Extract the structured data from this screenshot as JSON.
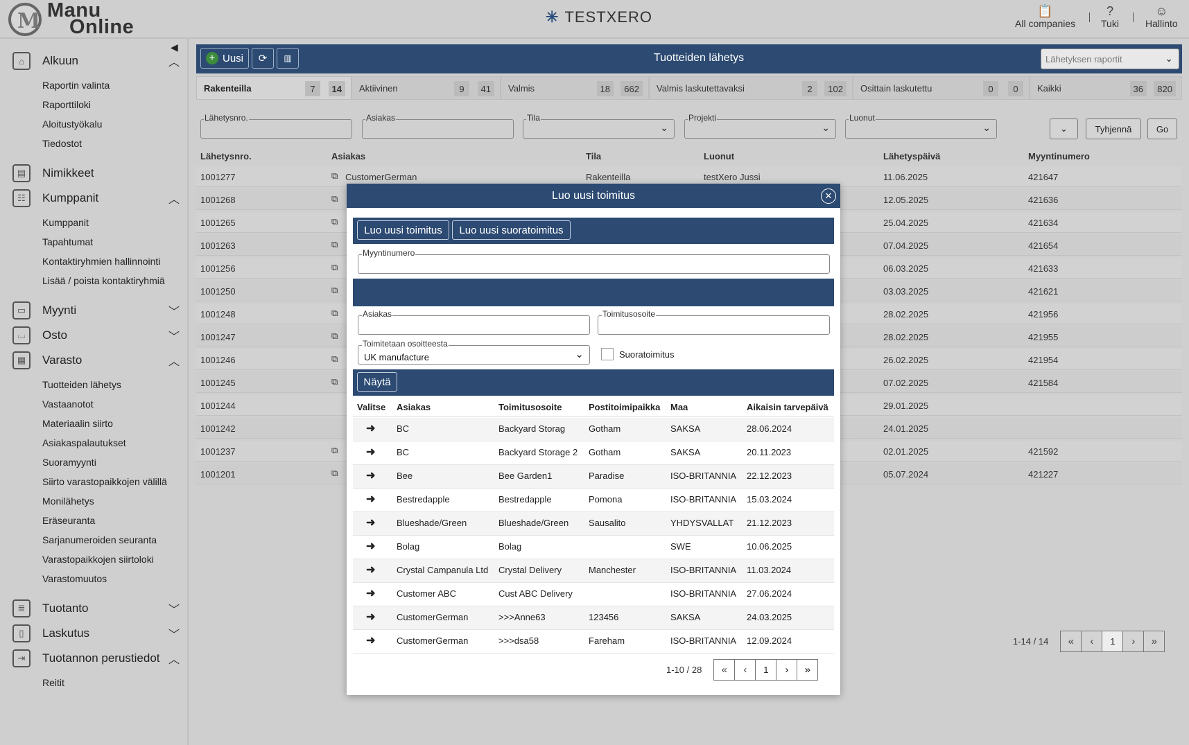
{
  "header": {
    "logo_line1": "Manu",
    "logo_line2": "Online",
    "company": "TESTXERO",
    "all_companies": "All companies",
    "support": "Tuki",
    "admin": "Hallinto"
  },
  "sidebar": {
    "sections": [
      {
        "label": "Alkuun",
        "icon": "home-icon",
        "chevron": "up",
        "items": [
          "Raportin valinta",
          "Raporttiloki",
          "Aloitustyökalu",
          "Tiedostot"
        ]
      },
      {
        "label": "Nimikkeet",
        "icon": "inbox-icon",
        "chevron": "",
        "items": []
      },
      {
        "label": "Kumppanit",
        "icon": "contacts-icon",
        "chevron": "up",
        "items": [
          "Kumppanit",
          "Tapahtumat",
          "Kontaktiryhmien hallinnointi",
          "Lisää / poista kontaktiryhmiä"
        ]
      },
      {
        "label": "Myynti",
        "icon": "register-icon",
        "chevron": "down",
        "items": []
      },
      {
        "label": "Osto",
        "icon": "basket-icon",
        "chevron": "down",
        "items": []
      },
      {
        "label": "Varasto",
        "icon": "warehouse-icon",
        "chevron": "up",
        "items": [
          "Tuotteiden lähetys",
          "Vastaanotot",
          "Materiaalin siirto",
          "Asiakaspalautukset",
          "Suoramyynti",
          "Siirto varastopaikkojen välillä",
          "Monilähetys",
          "Eräseuranta",
          "Sarjanumeroiden seuranta",
          "Varastopaikkojen siirtoloki",
          "Varastomuutos"
        ]
      },
      {
        "label": "Tuotanto",
        "icon": "database-icon",
        "chevron": "down",
        "items": []
      },
      {
        "label": "Laskutus",
        "icon": "invoice-icon",
        "chevron": "down",
        "items": []
      },
      {
        "label": "Tuotannon perustiedot",
        "icon": "export-icon",
        "chevron": "up",
        "items": [
          "Reitit"
        ]
      }
    ]
  },
  "toolbar": {
    "new_label": "Uusi",
    "title": "Tuotteiden lähetys",
    "reports_placeholder": "Lähetyksen raportit"
  },
  "tabs": [
    {
      "label": "Rakenteilla",
      "a": "7",
      "b": "14"
    },
    {
      "label": "Aktiivinen",
      "a": "9",
      "b": "41"
    },
    {
      "label": "Valmis",
      "a": "18",
      "b": "662"
    },
    {
      "label": "Valmis laskutettavaksi",
      "a": "2",
      "b": "102"
    },
    {
      "label": "Osittain laskutettu",
      "a": "0",
      "b": "0"
    },
    {
      "label": "Kaikki",
      "a": "36",
      "b": "820"
    }
  ],
  "filters": {
    "shipment_no": "Lähetysnro.",
    "customer": "Asiakas",
    "status": "Tila",
    "project": "Projekti",
    "created_by": "Luonut",
    "clear": "Tyhjennä",
    "go": "Go"
  },
  "grid": {
    "columns": [
      "Lähetysnro.",
      "Asiakas",
      "Tila",
      "Luonut",
      "Lähetyspäivä",
      "Myyntinumero"
    ],
    "rows": [
      {
        "no": "1001277",
        "customer": "CustomerGerman",
        "status": "Rakenteilla",
        "by": "testXero Jussi",
        "date": "11.06.2025",
        "sales": "421647",
        "ext": true
      },
      {
        "no": "1001268",
        "customer": "",
        "status": "",
        "by": "",
        "date": "12.05.2025",
        "sales": "421636",
        "ext": true
      },
      {
        "no": "1001265",
        "customer": "",
        "status": "",
        "by": "",
        "date": "25.04.2025",
        "sales": "421634",
        "ext": true
      },
      {
        "no": "1001263",
        "customer": "",
        "status": "",
        "by": "",
        "date": "07.04.2025",
        "sales": "421654",
        "ext": true
      },
      {
        "no": "1001256",
        "customer": "",
        "status": "",
        "by": "",
        "date": "06.03.2025",
        "sales": "421633",
        "ext": true
      },
      {
        "no": "1001250",
        "customer": "",
        "status": "",
        "by": "",
        "date": "03.03.2025",
        "sales": "421621",
        "ext": true
      },
      {
        "no": "1001248",
        "customer": "",
        "status": "",
        "by": "",
        "date": "28.02.2025",
        "sales": "421956",
        "ext": true
      },
      {
        "no": "1001247",
        "customer": "",
        "status": "",
        "by": "",
        "date": "28.02.2025",
        "sales": "421955",
        "ext": true
      },
      {
        "no": "1001246",
        "customer": "",
        "status": "",
        "by": "",
        "date": "26.02.2025",
        "sales": "421954",
        "ext": true
      },
      {
        "no": "1001245",
        "customer": "",
        "status": "",
        "by": "",
        "date": "07.02.2025",
        "sales": "421584",
        "ext": true
      },
      {
        "no": "1001244",
        "customer": "",
        "status": "",
        "by": "",
        "date": "29.01.2025",
        "sales": "",
        "ext": false
      },
      {
        "no": "1001242",
        "customer": "",
        "status": "",
        "by": "",
        "date": "24.01.2025",
        "sales": "",
        "ext": false
      },
      {
        "no": "1001237",
        "customer": "",
        "status": "",
        "by": "",
        "date": "02.01.2025",
        "sales": "421592",
        "ext": true
      },
      {
        "no": "1001201",
        "customer": "",
        "status": "",
        "by": "",
        "date": "05.07.2024",
        "sales": "421227",
        "ext": true
      }
    ],
    "pager_info": "1-14 / 14",
    "page": "1"
  },
  "modal": {
    "title": "Luo uusi toimitus",
    "btn_new_delivery": "Luo uusi toimitus",
    "btn_new_direct": "Luo uusi suoratoimitus",
    "sales_no_label": "Myyntinumero",
    "customer_label": "Asiakas",
    "address_label": "Toimitusosoite",
    "from_label": "Toimitetaan osoitteesta",
    "from_value": "UK manufacture",
    "direct_label": "Suoratoimitus",
    "show_btn": "Näytä",
    "columns": [
      "Valitse",
      "Asiakas",
      "Toimitusosoite",
      "Postitoimipaikka",
      "Maa",
      "Aikaisin tarvepäivä"
    ],
    "rows": [
      {
        "customer": "BC",
        "address": "Backyard Storag",
        "city": "Gotham",
        "country": "SAKSA",
        "date": "28.06.2024"
      },
      {
        "customer": "BC",
        "address": "Backyard Storage 2",
        "city": "Gotham",
        "country": "SAKSA",
        "date": "20.11.2023"
      },
      {
        "customer": "Bee",
        "address": "Bee Garden1",
        "city": "Paradise",
        "country": "ISO-BRITANNIA",
        "date": "22.12.2023"
      },
      {
        "customer": "Bestredapple",
        "address": "Bestredapple",
        "city": "Pomona",
        "country": "ISO-BRITANNIA",
        "date": "15.03.2024"
      },
      {
        "customer": "Blueshade/Green",
        "address": "Blueshade/Green",
        "city": "Sausalito",
        "country": "YHDYSVALLAT",
        "date": "21.12.2023"
      },
      {
        "customer": "Bolag",
        "address": "Bolag",
        "city": "",
        "country": "SWE",
        "date": "10.06.2025"
      },
      {
        "customer": "Crystal Campanula Ltd",
        "address": "Crystal Delivery",
        "city": "Manchester",
        "country": "ISO-BRITANNIA",
        "date": "11.03.2024"
      },
      {
        "customer": "Customer ABC",
        "address": "Cust ABC Delivery",
        "city": "",
        "country": "ISO-BRITANNIA",
        "date": "27.06.2024"
      },
      {
        "customer": "CustomerGerman",
        "address": ">>>Anne63",
        "city": "123456",
        "country": "SAKSA",
        "date": "24.03.2025"
      },
      {
        "customer": "CustomerGerman",
        "address": ">>>dsa58",
        "city": "Fareham",
        "country": "ISO-BRITANNIA",
        "date": "12.09.2024"
      }
    ],
    "pager_info": "1-10 / 28",
    "page": "1"
  },
  "colors": {
    "accent": "#2c4a72",
    "background": "#cfcfcf"
  }
}
